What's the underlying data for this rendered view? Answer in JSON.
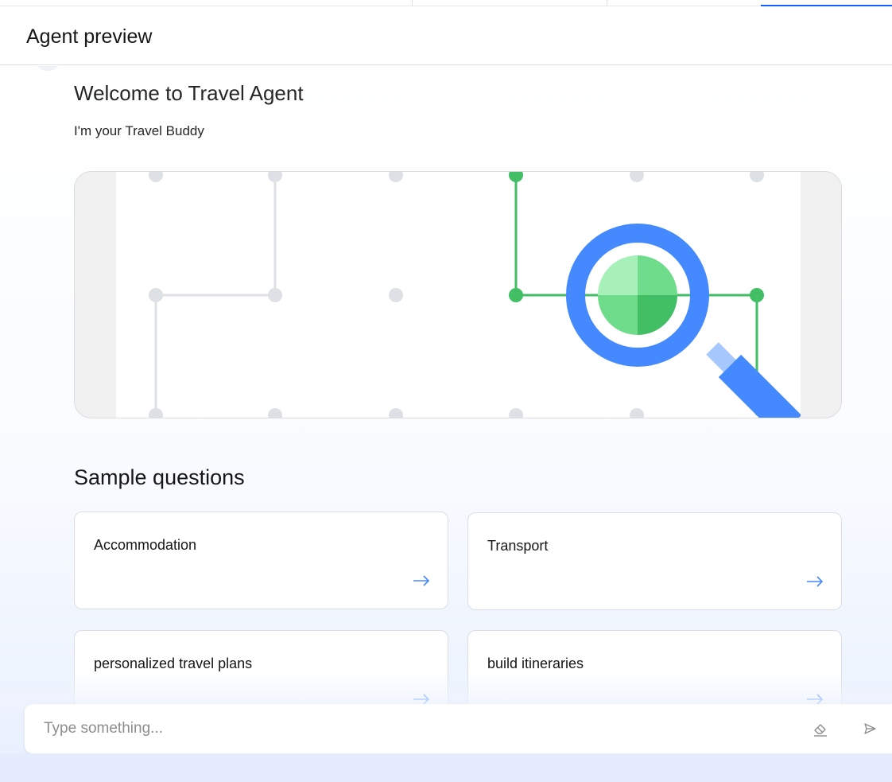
{
  "header": {
    "title": "Agent preview"
  },
  "welcome": {
    "title": "Welcome to Travel Agent",
    "subtitle": "I'm your Travel Buddy"
  },
  "banner": {
    "illustration": "magnifying-glass-network-illustration"
  },
  "sample_questions": {
    "title": "Sample questions",
    "items": [
      {
        "label": "Accommodation"
      },
      {
        "label": "Transport"
      },
      {
        "label": "personalized travel plans"
      },
      {
        "label": "build itineraries"
      }
    ]
  },
  "input": {
    "placeholder": "Type something...",
    "value": ""
  },
  "icons": {
    "card_arrow": "arrow-right-icon",
    "clear": "eraser-icon",
    "send": "send-icon"
  },
  "colors": {
    "accent": "#0f62fe",
    "arrow": "#4589ff",
    "green": "#42be65",
    "magnifier": "#4589ff"
  }
}
